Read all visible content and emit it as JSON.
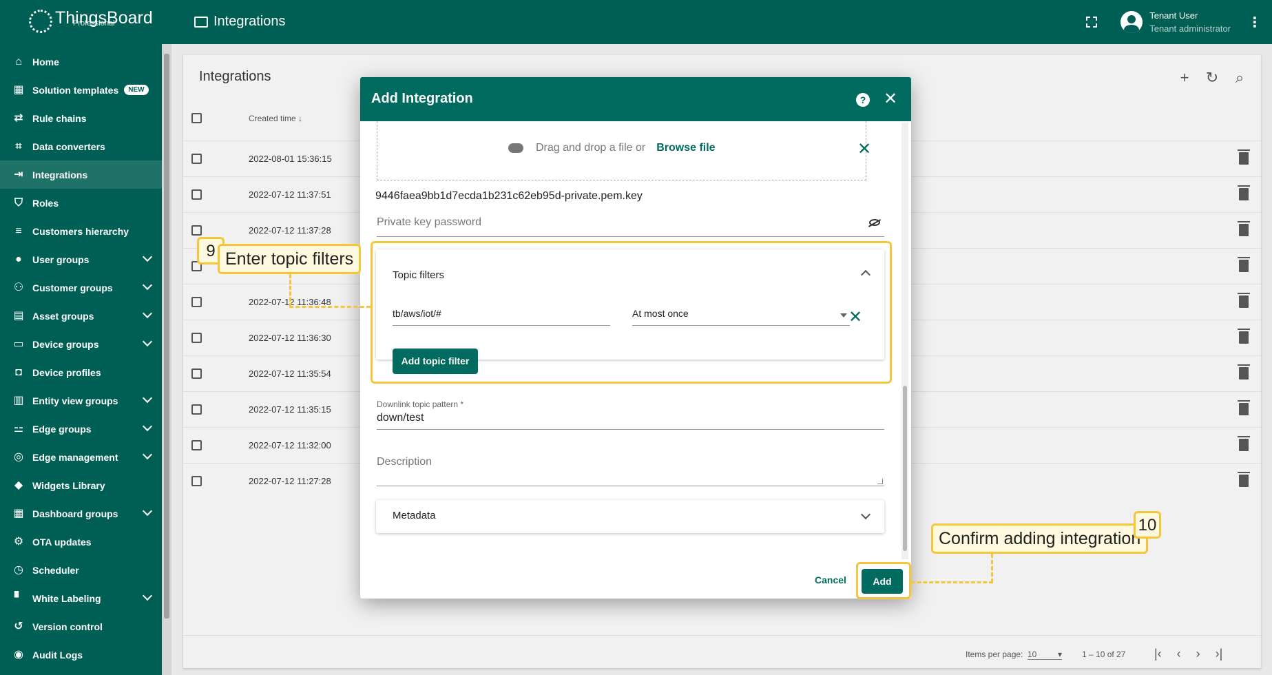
{
  "app": {
    "logo_text": "ThingsBoard",
    "logo_sub": "Professional",
    "page_title": "Integrations"
  },
  "user": {
    "name": "Tenant User",
    "role": "Tenant administrator"
  },
  "sidebar": {
    "items": [
      {
        "label": "Home",
        "icon": "home-icon",
        "glyph": "⌂",
        "expandable": false
      },
      {
        "label": "Solution templates",
        "icon": "grid-icon",
        "glyph": "▦",
        "expandable": false,
        "badge": "NEW"
      },
      {
        "label": "Rule chains",
        "icon": "rule-chain-icon",
        "glyph": "⇄",
        "expandable": false
      },
      {
        "label": "Data converters",
        "icon": "crop-icon",
        "glyph": "⌗",
        "expandable": false
      },
      {
        "label": "Integrations",
        "icon": "input-icon",
        "glyph": "⇥",
        "expandable": false,
        "active": true
      },
      {
        "label": "Roles",
        "icon": "shield-icon",
        "glyph": "⛉",
        "expandable": false
      },
      {
        "label": "Customers hierarchy",
        "icon": "sort-icon",
        "glyph": "≡",
        "expandable": false
      },
      {
        "label": "User groups",
        "icon": "account-circle-icon",
        "glyph": "●",
        "expandable": true
      },
      {
        "label": "Customer groups",
        "icon": "people-icon",
        "glyph": "⚇",
        "expandable": true
      },
      {
        "label": "Asset groups",
        "icon": "domain-icon",
        "glyph": "▤",
        "expandable": true
      },
      {
        "label": "Device groups",
        "icon": "devices-icon",
        "glyph": "▭",
        "expandable": true
      },
      {
        "label": "Device profiles",
        "icon": "device-profile-icon",
        "glyph": "◘",
        "expandable": false
      },
      {
        "label": "Entity view groups",
        "icon": "view-quilt-icon",
        "glyph": "▥",
        "expandable": true
      },
      {
        "label": "Edge groups",
        "icon": "router-icon",
        "glyph": "⚍",
        "expandable": true
      },
      {
        "label": "Edge management",
        "icon": "settings-input-antenna-icon",
        "glyph": "◎",
        "expandable": true
      },
      {
        "label": "Widgets Library",
        "icon": "widgets-icon",
        "glyph": "◆",
        "expandable": false
      },
      {
        "label": "Dashboard groups",
        "icon": "dashboard-icon",
        "glyph": "▦",
        "expandable": true
      },
      {
        "label": "OTA updates",
        "icon": "memory-icon",
        "glyph": "⚙",
        "expandable": false
      },
      {
        "label": "Scheduler",
        "icon": "schedule-icon",
        "glyph": "◷",
        "expandable": false
      },
      {
        "label": "White Labeling",
        "icon": "format-paint-icon",
        "glyph": "▘",
        "expandable": true
      },
      {
        "label": "Version control",
        "icon": "history-icon",
        "glyph": "↺",
        "expandable": false
      },
      {
        "label": "Audit Logs",
        "icon": "track-changes-icon",
        "glyph": "◉",
        "expandable": false
      }
    ]
  },
  "list": {
    "title": "Integrations",
    "column_created": "Created time",
    "rows": [
      "2022-08-01 15:36:15",
      "2022-07-12 11:37:51",
      "2022-07-12 11:37:28",
      "",
      "2022-07-12 11:36:48",
      "2022-07-12 11:36:30",
      "2022-07-12 11:35:54",
      "2022-07-12 11:35:15",
      "2022-07-12 11:32:00",
      "2022-07-12 11:27:28"
    ],
    "paginator": {
      "items_per_page_label": "Items per page:",
      "items_per_page": "10",
      "range": "1 – 10 of 27"
    }
  },
  "dialog": {
    "title": "Add Integration",
    "drop_text": "Drag and drop a file or",
    "browse_link": "Browse file",
    "filename": "9446faea9bb1d7ecda1b231c62eb95d-private.pem.key",
    "private_key_password_placeholder": "Private key password",
    "topic_filters": {
      "title": "Topic filters",
      "topic": "tb/aws/iot/#",
      "qos": "At most once",
      "add_button": "Add topic filter"
    },
    "downlink": {
      "label": "Downlink topic pattern *",
      "value": "down/test"
    },
    "description_placeholder": "Description",
    "metadata_title": "Metadata",
    "cancel_label": "Cancel",
    "add_label": "Add"
  },
  "callouts": {
    "step9_num": "9",
    "step9_text": "Enter topic filters",
    "step10_num": "10",
    "step10_text": "Confirm adding integration"
  },
  "colors": {
    "primary": "#005f54",
    "dialog_header": "#006b5e",
    "highlight": "#f5c53a"
  }
}
